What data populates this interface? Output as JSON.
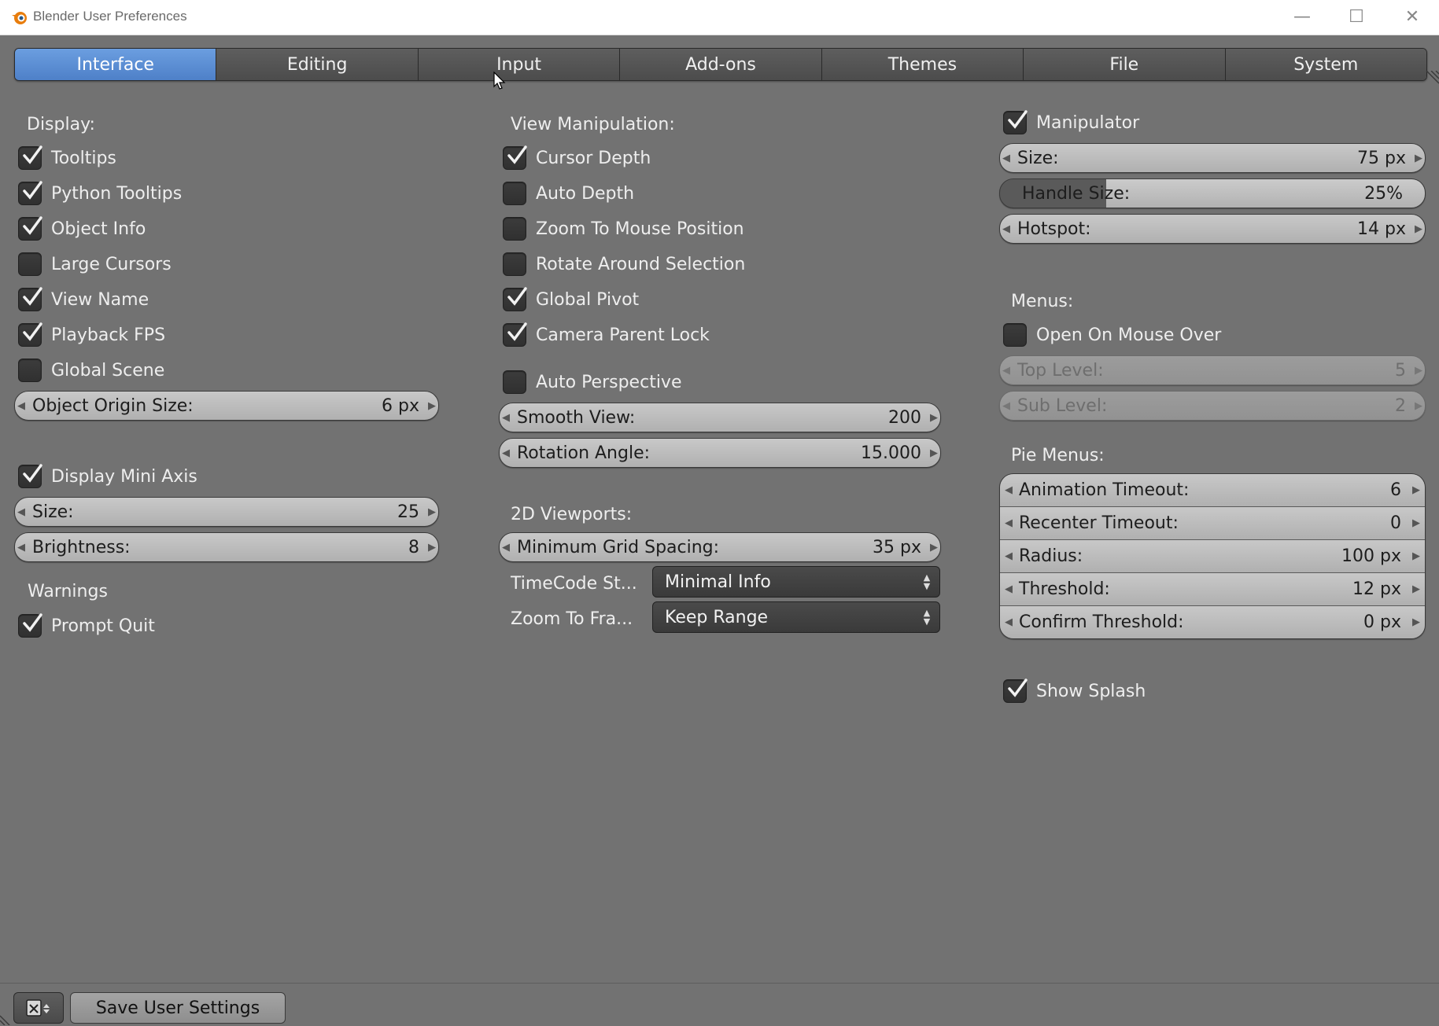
{
  "window": {
    "title": "Blender User Preferences",
    "minimize_glyph": "—",
    "maximize_glyph": "☐",
    "close_glyph": "✕"
  },
  "tabs": [
    {
      "label": "Interface",
      "active": true
    },
    {
      "label": "Editing"
    },
    {
      "label": "Input"
    },
    {
      "label": "Add-ons"
    },
    {
      "label": "Themes"
    },
    {
      "label": "File"
    },
    {
      "label": "System"
    }
  ],
  "col1": {
    "display_header": "Display:",
    "checks": [
      {
        "label": "Tooltips",
        "checked": true
      },
      {
        "label": "Python Tooltips",
        "checked": true
      },
      {
        "label": "Object Info",
        "checked": true
      },
      {
        "label": "Large Cursors",
        "checked": false
      },
      {
        "label": "View Name",
        "checked": true
      },
      {
        "label": "Playback FPS",
        "checked": true
      },
      {
        "label": "Global Scene",
        "checked": false
      }
    ],
    "object_origin": {
      "label": "Object Origin Size:",
      "value": "6 px"
    },
    "mini_axis": {
      "label": "Display Mini Axis",
      "checked": true
    },
    "size": {
      "label": "Size:",
      "value": "25"
    },
    "brightness": {
      "label": "Brightness:",
      "value": "8"
    },
    "warnings_header": "Warnings",
    "prompt_quit": {
      "label": "Prompt Quit",
      "checked": true
    }
  },
  "col2": {
    "view_header": "View Manipulation:",
    "checks": [
      {
        "label": "Cursor Depth",
        "checked": true
      },
      {
        "label": "Auto Depth",
        "checked": false
      },
      {
        "label": "Zoom To Mouse Position",
        "checked": false
      },
      {
        "label": "Rotate Around Selection",
        "checked": false
      },
      {
        "label": "Global Pivot",
        "checked": true
      },
      {
        "label": "Camera Parent Lock",
        "checked": true
      }
    ],
    "auto_perspective": {
      "label": "Auto Perspective",
      "checked": false
    },
    "smooth_view": {
      "label": "Smooth View:",
      "value": "200"
    },
    "rotation_angle": {
      "label": "Rotation Angle:",
      "value": "15.000"
    },
    "viewports_header": "2D Viewports:",
    "grid_spacing": {
      "label": "Minimum Grid Spacing:",
      "value": "35 px"
    },
    "timecode": {
      "label": "TimeCode St...",
      "value": "Minimal Info"
    },
    "zoom_to_frame": {
      "label": "Zoom To Fra...",
      "value": "Keep Range"
    }
  },
  "col3": {
    "manipulator": {
      "label": "Manipulator",
      "checked": true
    },
    "size": {
      "label": "Size:",
      "value": "75 px"
    },
    "handle_size": {
      "label": "Handle Size:",
      "value": "25%",
      "fraction": 0.25
    },
    "hotspot": {
      "label": "Hotspot:",
      "value": "14 px"
    },
    "menus_header": "Menus:",
    "open_on_mouse_over": {
      "label": "Open On Mouse Over",
      "checked": false
    },
    "top_level": {
      "label": "Top Level:",
      "value": "5"
    },
    "sub_level": {
      "label": "Sub Level:",
      "value": "2"
    },
    "pie_header": "Pie Menus:",
    "pie_items": [
      {
        "label": "Animation Timeout:",
        "value": "6"
      },
      {
        "label": "Recenter Timeout:",
        "value": "0"
      },
      {
        "label": "Radius:",
        "value": "100 px"
      },
      {
        "label": "Threshold:",
        "value": "12 px"
      },
      {
        "label": "Confirm Threshold:",
        "value": "0 px"
      }
    ],
    "show_splash": {
      "label": "Show Splash",
      "checked": true
    }
  },
  "footer": {
    "save_label": "Save User Settings",
    "editor_icon": "user-preferences-editor-icon"
  },
  "colors": {
    "active_tab": "#5a8cd6",
    "panel_bg": "#727272",
    "field_bg": "#bdbdbd"
  }
}
